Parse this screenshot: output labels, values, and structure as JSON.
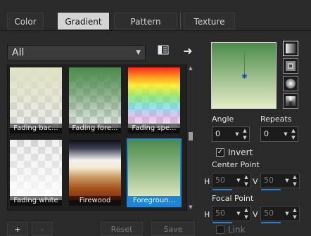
{
  "tabs": [
    {
      "label": "Color",
      "active": false
    },
    {
      "label": "Gradient",
      "active": true
    },
    {
      "label": "Pattern",
      "active": false
    },
    {
      "label": "Texture",
      "active": false
    }
  ],
  "category": {
    "selected": "All"
  },
  "gradients": [
    {
      "label": "Fading bac..."
    },
    {
      "label": "Fading fore..."
    },
    {
      "label": "Fading spe..."
    },
    {
      "label": "Fading white"
    },
    {
      "label": "Firewood"
    },
    {
      "label": "Foregroun..."
    }
  ],
  "bottom": {
    "add_label": "+",
    "remove_label": "-",
    "reset_label": "Reset",
    "save_label": "Save"
  },
  "angle": {
    "label": "Angle",
    "value": "0"
  },
  "repeats": {
    "label": "Repeats",
    "value": "0"
  },
  "invert": {
    "label": "Invert",
    "checked": true
  },
  "center_point": {
    "label": "Center Point",
    "h_label": "H",
    "h_value": "50",
    "v_label": "V",
    "v_value": "50"
  },
  "focal_point": {
    "label": "Focal Point",
    "h_label": "H",
    "h_value": "50",
    "v_label": "V",
    "v_value": "50"
  },
  "link": {
    "label": "Link",
    "checked": false
  },
  "colors": {
    "accent": "#1f86d6",
    "preview_top": "#4b8a4c",
    "preview_bottom": "#e4ebc7"
  },
  "icons": [
    "chevron-down-icon",
    "list-icon",
    "arrow-right-icon",
    "linear-style-icon",
    "rectangular-style-icon",
    "sunburst-style-icon",
    "radial-style-icon"
  ]
}
